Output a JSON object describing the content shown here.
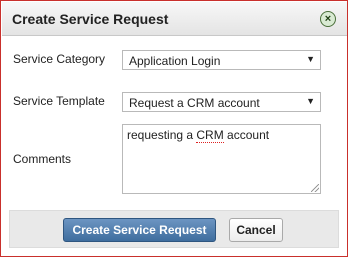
{
  "dialog": {
    "title": "Create Service Request",
    "close_glyph": "×"
  },
  "form": {
    "category": {
      "label": "Service Category",
      "value": "Application Login"
    },
    "template": {
      "label": "Service Template",
      "value": "Request a CRM account"
    },
    "comments": {
      "label": "Comments",
      "prefix": "requesting a ",
      "misspelled": "CRM",
      "suffix": " account"
    },
    "dropdown_arrow": "▼"
  },
  "buttons": {
    "submit": "Create Service Request",
    "cancel": "Cancel"
  },
  "colors": {
    "primary_button": "#4f7cab",
    "frame_border": "#c9302c"
  }
}
